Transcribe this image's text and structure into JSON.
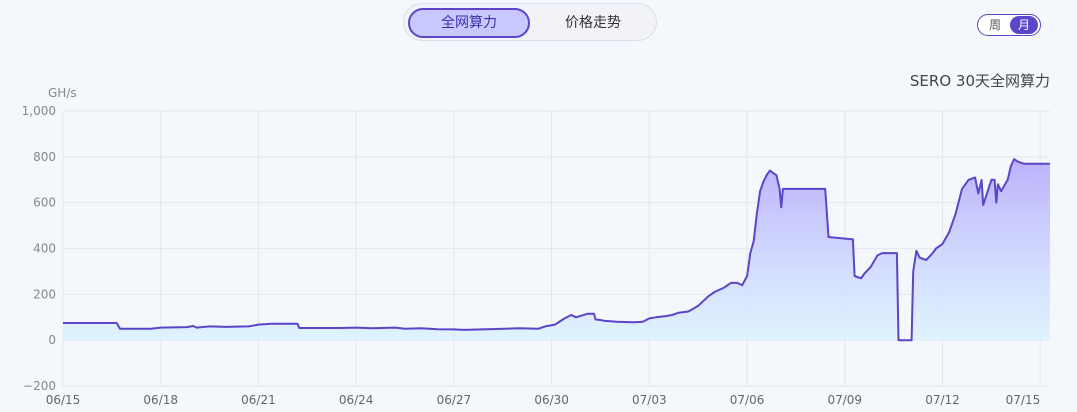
{
  "tabs": [
    {
      "label": "全网算力",
      "active": true
    },
    {
      "label": "价格走势",
      "active": false
    }
  ],
  "range_toggle": {
    "week_label": "周",
    "month_label": "月",
    "selected": "月"
  },
  "colors": {
    "accent": "#5b45c8",
    "line": "#5b45c8",
    "fill_top": "#b9aefc",
    "fill_bottom": "#d9f2ff"
  },
  "chart_data": {
    "type": "area",
    "title": "SERO 30天全网算力",
    "ylabel": "GH/s",
    "xlabel": "",
    "ylim": [
      -200,
      1000
    ],
    "y_ticks": [
      "1,000",
      "800",
      "600",
      "400",
      "200",
      "0",
      "−200"
    ],
    "y_tick_values": [
      1000,
      800,
      600,
      400,
      200,
      0,
      -200
    ],
    "x_tick_labels": [
      "06/15",
      "06/18",
      "06/21",
      "06/24",
      "06/27",
      "06/30",
      "07/03",
      "07/06",
      "07/09",
      "07/12",
      "07/15"
    ],
    "x_tick_days": [
      0,
      3,
      6,
      9,
      12,
      15,
      18,
      21,
      24,
      27,
      30
    ],
    "grid": true,
    "legend": "none",
    "series": [
      {
        "x_day": [
          0,
          1.65,
          1.75,
          2.7,
          3.0,
          3.8,
          4.0,
          4.1,
          4.5,
          5.0,
          5.7,
          6.0,
          6.4,
          7.2,
          7.25,
          8.5,
          9.0,
          9.5,
          10.2,
          10.5,
          11.0,
          11.5,
          12.0,
          12.3,
          13.0,
          14.0,
          14.6,
          14.8,
          15.1,
          15.4,
          15.6,
          15.75,
          16.1,
          16.3,
          16.35,
          16.5,
          16.6,
          17.0,
          17.5,
          17.8,
          18.0,
          18.2,
          18.5,
          18.7,
          18.9,
          19.2,
          19.5,
          19.8,
          20.0,
          20.3,
          20.5,
          20.7,
          20.85,
          21.0,
          21.1,
          21.2,
          21.3,
          21.4,
          21.5,
          21.6,
          21.7,
          21.8,
          21.9,
          22.0,
          22.05,
          22.1,
          22.3,
          23.2,
          23.4,
          23.5,
          24.2,
          24.25,
          24.3,
          24.5,
          24.6,
          24.8,
          25.0,
          25.15,
          25.25,
          25.6,
          25.65,
          25.75,
          26.0,
          26.05,
          26.1,
          26.2,
          26.3,
          26.5,
          26.7,
          26.8,
          27.0,
          27.2,
          27.4,
          27.6,
          27.8,
          28.0,
          28.1,
          28.2,
          28.25,
          28.5,
          28.6,
          28.65,
          28.7,
          28.8,
          29.0,
          29.1,
          29.2,
          29.3,
          29.5,
          29.7,
          30.0,
          30.3
        ],
        "y": [
          75,
          75,
          50,
          50,
          55,
          57,
          62,
          55,
          60,
          58,
          60,
          68,
          72,
          72,
          53,
          53,
          55,
          52,
          55,
          50,
          52,
          48,
          47,
          45,
          48,
          52,
          50,
          60,
          68,
          95,
          110,
          100,
          115,
          115,
          90,
          88,
          85,
          80,
          78,
          80,
          95,
          100,
          105,
          110,
          120,
          125,
          150,
          190,
          210,
          230,
          250,
          250,
          240,
          280,
          380,
          430,
          550,
          650,
          690,
          720,
          740,
          730,
          720,
          660,
          580,
          660,
          660,
          660,
          660,
          450,
          440,
          440,
          280,
          270,
          290,
          320,
          370,
          380,
          380,
          380,
          0,
          0,
          0,
          0,
          300,
          390,
          360,
          350,
          380,
          400,
          420,
          470,
          550,
          660,
          700,
          710,
          640,
          700,
          590,
          700,
          700,
          600,
          680,
          650,
          700,
          760,
          790,
          780,
          770,
          770,
          770,
          770
        ]
      }
    ]
  }
}
